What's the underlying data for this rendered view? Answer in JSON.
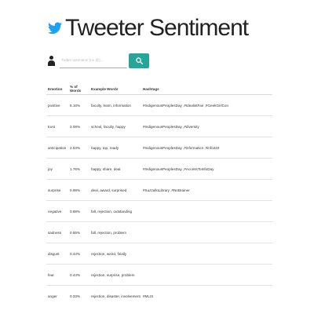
{
  "header": {
    "title": "Tweeter Sentiment",
    "logo_icon": "twitter-bird-icon",
    "logo_color": "#1da1f2"
  },
  "search": {
    "user_icon": "person-icon",
    "placeholder": "Twitter username (no @)...",
    "value": "",
    "button_icon": "search-icon",
    "button_color": "#26a69a"
  },
  "table": {
    "headers": [
      "Emotion",
      "% of Words",
      "Example Words",
      "Hashtags"
    ],
    "rows": [
      {
        "emotion": "positive",
        "percent": "6.16%",
        "examples": "faculty, learn, information",
        "hashtags": "#IndigenousPeoplesDay ,#IdealistFair ,#GeekGirlCon"
      },
      {
        "emotion": "trust",
        "percent": "3.08%",
        "examples": "school, faculty, happy",
        "hashtags": "#IndigenousPeoplesDay ,#diversity"
      },
      {
        "emotion": "anticipation",
        "percent": "2.53%",
        "examples": "happy, top, ready",
        "hashtags": "#IndigenousPeoplesDay ,#informatics ,#info340"
      },
      {
        "emotion": "joy",
        "percent": "1.76%",
        "examples": "happy, share, deal",
        "hashtags": "#IndigenousPeoplesDay ,#AccessToInfoDay"
      },
      {
        "emotion": "surprise",
        "percent": "0.99%",
        "examples": "deal, award, surprised",
        "hashtags": "#SuzzalloLibrary ,#NoBrainer"
      },
      {
        "emotion": "negative",
        "percent": "0.88%",
        "examples": "fall, rejection, outstanding",
        "hashtags": ""
      },
      {
        "emotion": "sadness",
        "percent": "0.55%",
        "examples": "fall, rejection, problem",
        "hashtags": ""
      },
      {
        "emotion": "disgust",
        "percent": "0.44%",
        "examples": "rejection, weird, finally",
        "hashtags": ""
      },
      {
        "emotion": "fear",
        "percent": "0.44%",
        "examples": "rejection, surprise, problem",
        "hashtags": ""
      },
      {
        "emotion": "anger",
        "percent": "0.33%",
        "examples": "rejection, disaster, involvement",
        "hashtags": "#MLIS"
      }
    ]
  }
}
